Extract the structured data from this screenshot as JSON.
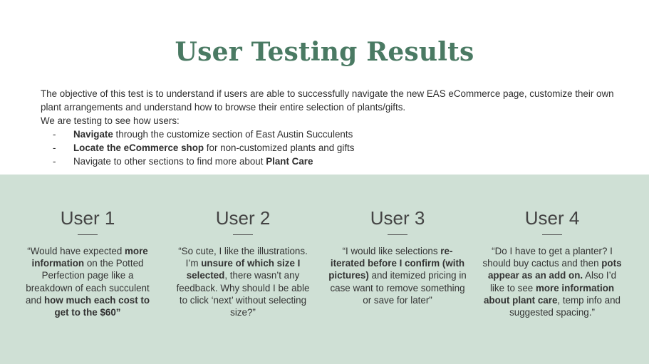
{
  "slide": {
    "title": "User Testing Results",
    "objective": "The objective of this test is to understand if users are able to successfully navigate the new EAS eCommerce page, customize their own plant arrangements and understand how to browse their entire selection of plants/gifts.",
    "testing_intro": "We are testing to see how users:",
    "bullet_marker": "-",
    "bullets": [
      {
        "bold": "Navigate",
        "rest": " through the customize section of East Austin Succulents"
      },
      {
        "bold": "Locate the eCommerce shop",
        "rest": " for non-customized plants and gifts"
      },
      {
        "pre": "Navigate to other sections to find more about ",
        "bold": "Plant Care"
      }
    ]
  },
  "users": [
    {
      "name": "User 1",
      "quote": [
        {
          "t": "“Would have expected "
        },
        {
          "t": "more information",
          "b": true
        },
        {
          "t": " on the Potted Perfection page like a breakdown of each succulent and "
        },
        {
          "t": "how much each cost to get to the $60”",
          "b": true
        }
      ]
    },
    {
      "name": "User 2",
      "quote": [
        {
          "t": "“So cute, I like the illustrations. I’m "
        },
        {
          "t": "unsure of which size I selected",
          "b": true
        },
        {
          "t": ", there wasn’t any feedback. Why should I be able to click ‘next’ without selecting size?”"
        }
      ]
    },
    {
      "name": "User 3",
      "quote": [
        {
          "t": "“I would like selections "
        },
        {
          "t": "re-iterated before I confirm (with pictures)",
          "b": true
        },
        {
          "t": " and itemized pricing in case want to remove something or save for later”"
        }
      ]
    },
    {
      "name": "User 4",
      "quote": [
        {
          "t": "“Do I have to get a planter? I should buy cactus and then "
        },
        {
          "t": "pots appear as an add on.",
          "b": true
        },
        {
          "t": " Also I’d like to see "
        },
        {
          "t": "more information about plant care",
          "b": true
        },
        {
          "t": ", temp info and suggested spacing.”"
        }
      ]
    }
  ],
  "colors": {
    "title": "#4a7a63",
    "panel_background": "#cfe0d5",
    "text": "#333333"
  }
}
